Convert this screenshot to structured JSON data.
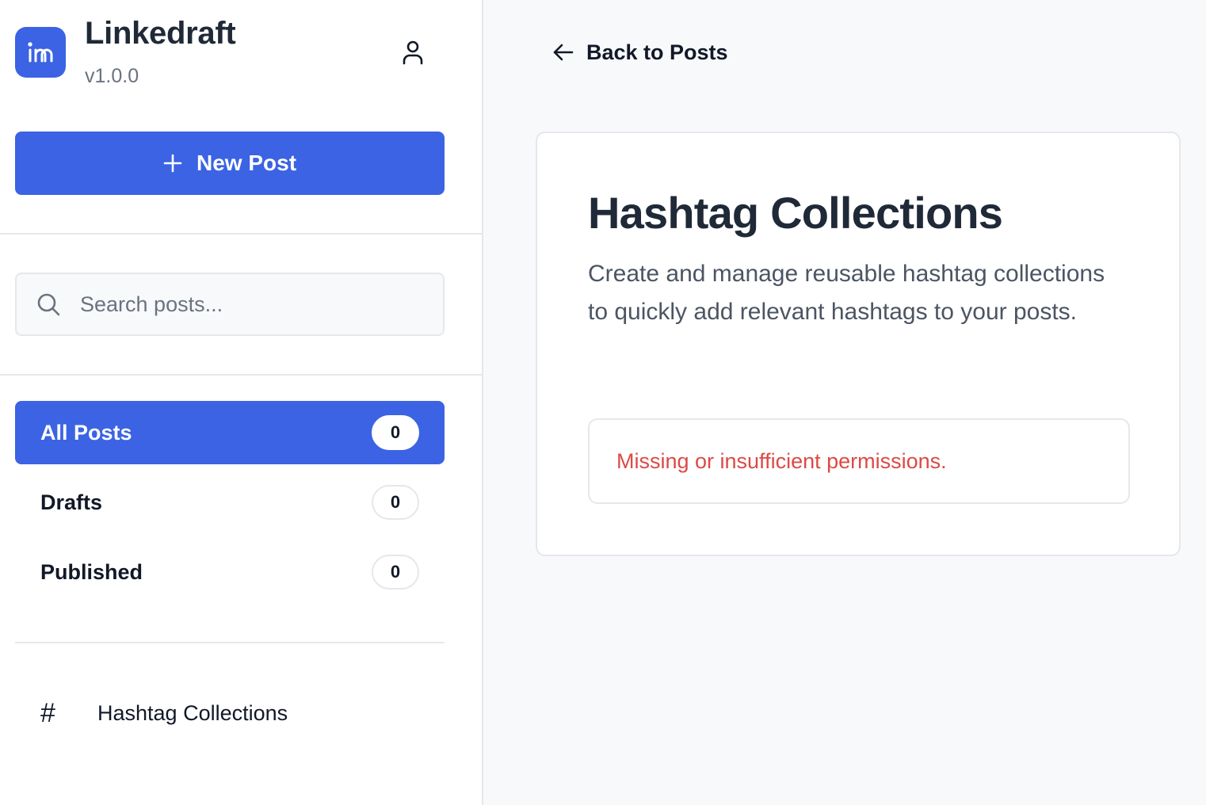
{
  "brand": {
    "name": "Linkedraft",
    "version": "v1.0.0",
    "logo_icon": "linkedin-icon",
    "accent_color": "#3b63e3"
  },
  "sidebar": {
    "new_post_label": "New Post",
    "search": {
      "placeholder": "Search posts...",
      "value": ""
    },
    "nav": [
      {
        "label": "All Posts",
        "count": "0",
        "active": true
      },
      {
        "label": "Drafts",
        "count": "0",
        "active": false
      },
      {
        "label": "Published",
        "count": "0",
        "active": false
      }
    ],
    "collections_link": {
      "icon": "#",
      "label": "Hashtag Collections"
    }
  },
  "main": {
    "back_label": "Back to Posts",
    "title": "Hashtag Collections",
    "description": "Create and manage reusable hashtag collections to quickly add relevant hashtags to your posts.",
    "error_message": "Missing or insufficient permissions.",
    "error_color": "#dc4a45"
  }
}
